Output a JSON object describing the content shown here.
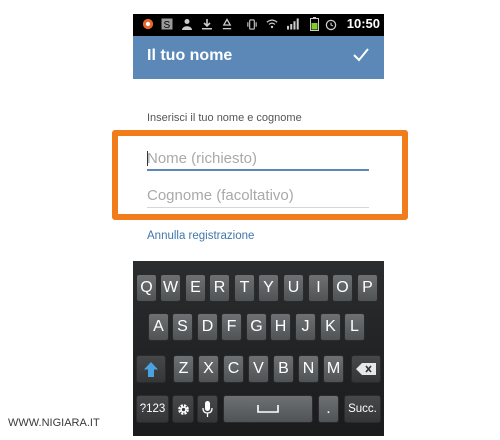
{
  "status_bar": {
    "time": "10:50",
    "icons": [
      "app-icon",
      "skype-icon",
      "person-icon",
      "download-icon",
      "recycle-icon",
      "vibrate-icon",
      "wifi-icon",
      "signal-icon",
      "battery-icon",
      "alarm-icon"
    ]
  },
  "action_bar": {
    "title": "Il tuo nome",
    "confirm_icon": "check-icon"
  },
  "form": {
    "instruction": "Inserisci il tuo nome e cognome",
    "first_name_placeholder": "Nome (richiesto)",
    "last_name_placeholder": "Cognome (facoltativo)",
    "cancel_link": "Annulla registrazione"
  },
  "keyboard": {
    "row1": [
      "Q",
      "W",
      "E",
      "R",
      "T",
      "Y",
      "U",
      "I",
      "O",
      "P"
    ],
    "row2": [
      "A",
      "S",
      "D",
      "F",
      "G",
      "H",
      "J",
      "K",
      "L"
    ],
    "row3": [
      "Z",
      "X",
      "C",
      "V",
      "B",
      "N",
      "M"
    ],
    "shift_icon": "shift-arrow-icon",
    "backspace_icon": "backspace-icon",
    "symbols": "?123",
    "settings_icon": "gear-icon",
    "mic_icon": "microphone-icon",
    "space_icon": "space-icon",
    "period": ".",
    "next": "Succ."
  },
  "colors": {
    "action_bar": "#5b88b7",
    "highlight": "#f07c1a",
    "shift": "#4aa3df",
    "link": "#3f77ab"
  },
  "watermark": "WWW.NIGIARA.IT"
}
